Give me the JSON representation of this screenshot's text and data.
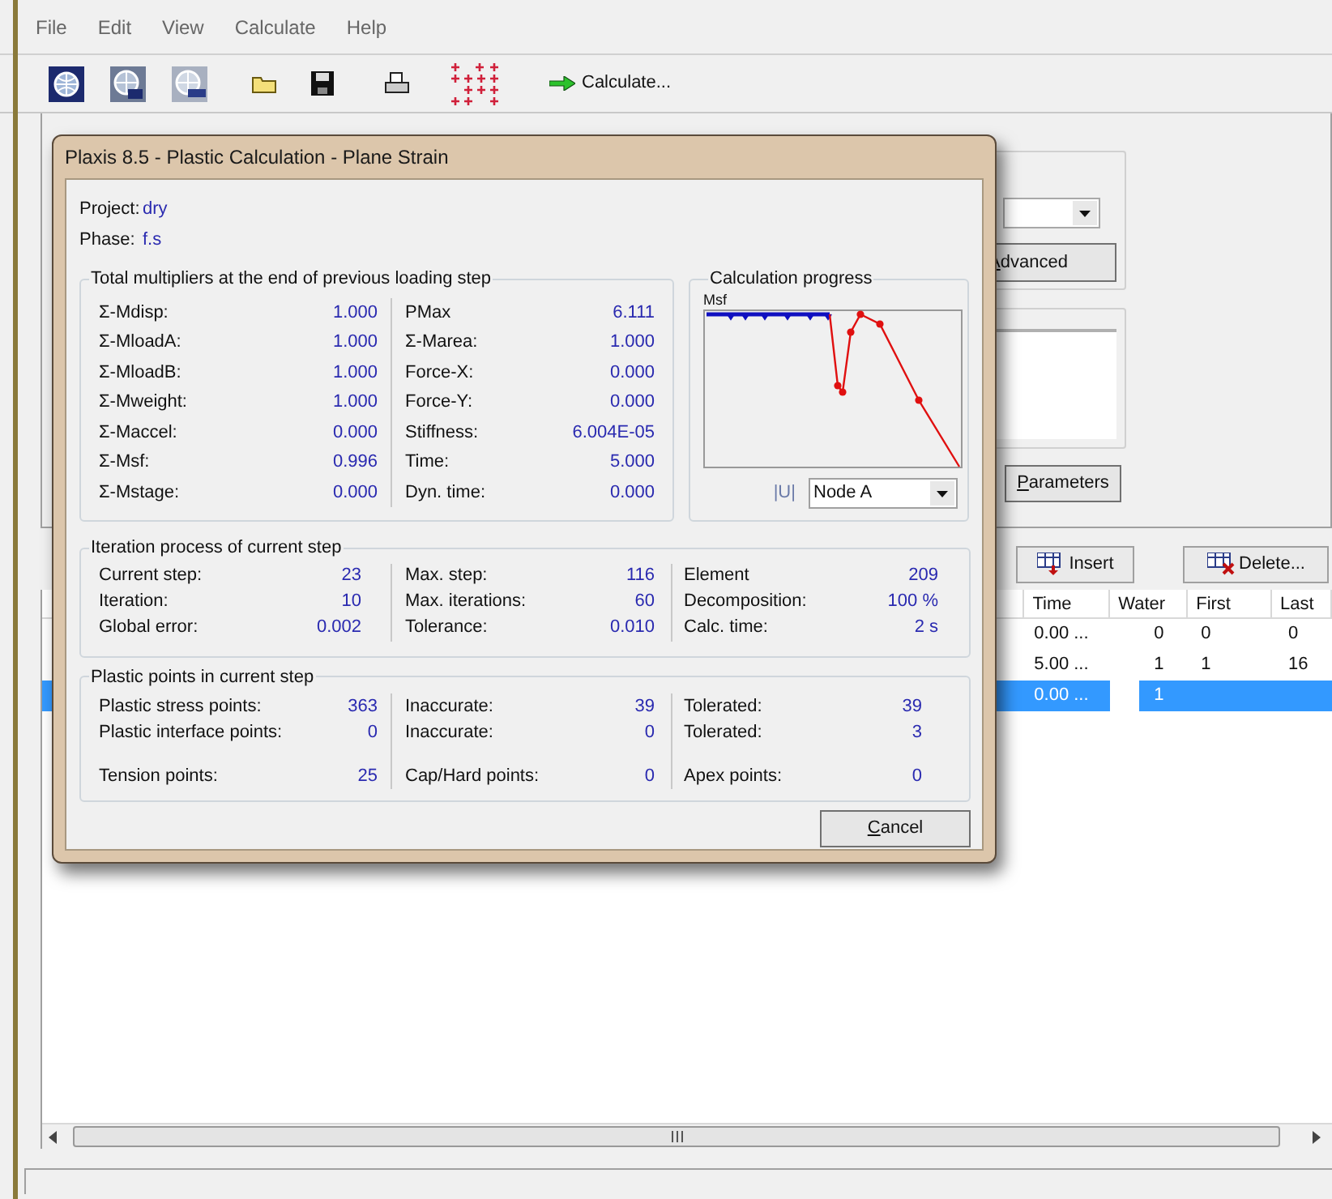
{
  "menu": [
    "File",
    "Edit",
    "View",
    "Calculate",
    "Help"
  ],
  "toolbar": {
    "calculate_button": "Calculate..."
  },
  "side_panel": {
    "advanced_button": "Advanced",
    "parameters_button": "Parameters"
  },
  "phase_buttons": {
    "insert": "Insert",
    "delete": "Delete..."
  },
  "table": {
    "columns": [
      "Time",
      "Water",
      "First",
      "Last"
    ],
    "rows": [
      {
        "time": "0.00 ...",
        "water": "0",
        "first": "0",
        "last": "0",
        "selected": false
      },
      {
        "time": "5.00 ...",
        "water": "1",
        "first": "1",
        "last": "16",
        "selected": false
      },
      {
        "time": "0.00 ...",
        "water": "1",
        "selected": true
      }
    ]
  },
  "dialog": {
    "title": "Plaxis 8.5 - Plastic Calculation - Plane Strain",
    "info": [
      {
        "label": "Project:",
        "value": "dry"
      },
      {
        "label": "Phase:",
        "value": "f.s"
      }
    ],
    "multipliers": {
      "title": "Total multipliers at the end of previous loading step",
      "columns": [
        [
          {
            "label": "Σ-Mdisp:",
            "value": "1.000"
          },
          {
            "label": "Σ-MloadA:",
            "value": "1.000"
          },
          {
            "label": "Σ-MloadB:",
            "value": "1.000"
          },
          {
            "label": "Σ-Mweight:",
            "value": "1.000"
          },
          {
            "label": "Σ-Maccel:",
            "value": "0.000"
          },
          {
            "label": "Σ-Msf:",
            "value": "0.996"
          },
          {
            "label": "Σ-Mstage:",
            "value": "0.000"
          }
        ],
        [
          {
            "label": "PMax",
            "value": "6.111"
          },
          {
            "label": "Σ-Marea:",
            "value": "1.000"
          },
          {
            "label": "Force-X:",
            "value": "0.000"
          },
          {
            "label": "Force-Y:",
            "value": "0.000"
          },
          {
            "label": "Stiffness:",
            "value": "6.004E-05"
          },
          {
            "label": "Time:",
            "value": "5.000"
          },
          {
            "label": "Dyn. time:",
            "value": "0.000"
          }
        ]
      ]
    },
    "progress": {
      "title": "Calculation progress",
      "axis_label": "Msf",
      "node_label": "|U|",
      "node": "Node A"
    },
    "iteration": {
      "title": "Iteration process of current step",
      "columns": [
        [
          {
            "label": "Current step:",
            "value": "23"
          },
          {
            "label": "Iteration:",
            "value": "10"
          },
          {
            "label": "Global error:",
            "value": "0.002"
          }
        ],
        [
          {
            "label": "Max. step:",
            "value": "116"
          },
          {
            "label": "Max. iterations:",
            "value": "60"
          },
          {
            "label": "Tolerance:",
            "value": "0.010"
          }
        ],
        [
          {
            "label": "Element",
            "value": "209"
          },
          {
            "label": "Decomposition:",
            "value": "100 %"
          },
          {
            "label": "Calc. time:",
            "value": "2 s"
          }
        ]
      ]
    },
    "plastic_points": {
      "title": "Plastic points in current step",
      "columns": [
        [
          {
            "label": "Plastic stress points:",
            "value": "363"
          },
          {
            "label": "Plastic interface points:",
            "value": "0"
          },
          {
            "label": "Tension points:",
            "value": "25"
          }
        ],
        [
          {
            "label": "Inaccurate:",
            "value": "39"
          },
          {
            "label": "Inaccurate:",
            "value": "0"
          },
          {
            "label": "Cap/Hard points:",
            "value": "0"
          }
        ],
        [
          {
            "label": "Tolerated:",
            "value": "39"
          },
          {
            "label": "Tolerated:",
            "value": "3"
          },
          {
            "label": "Apex points:",
            "value": "0"
          }
        ]
      ]
    },
    "cancel_button": "Cancel"
  }
}
